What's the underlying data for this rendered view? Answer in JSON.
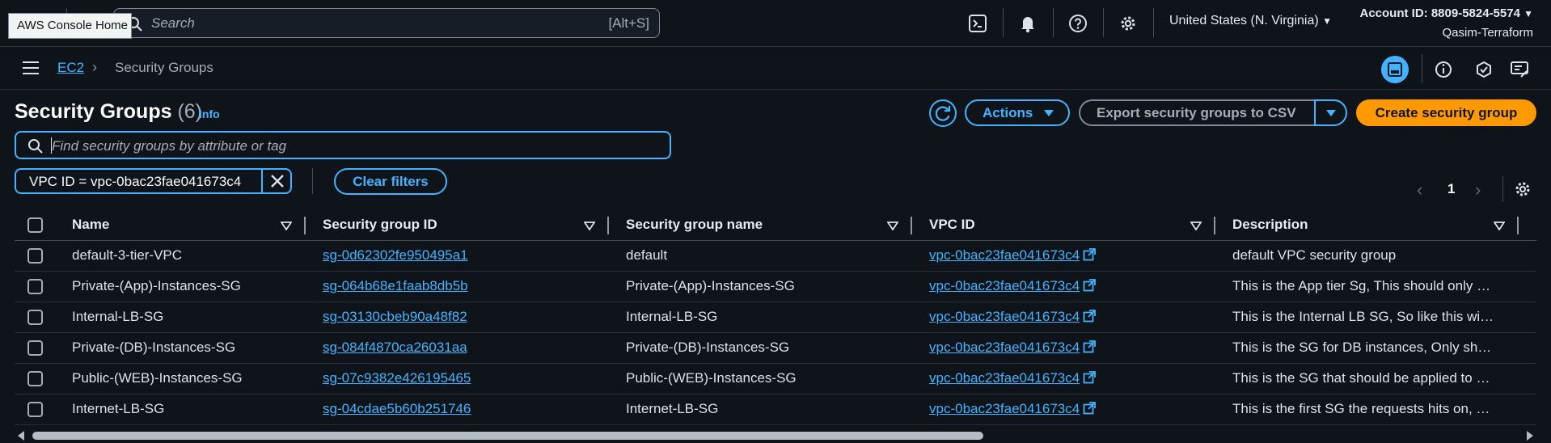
{
  "topnav": {
    "logo_text": "aws",
    "tooltip": "AWS Console Home",
    "search_placeholder": "Search",
    "search_shortcut": "[Alt+S]",
    "region": "United States (N. Virginia)",
    "account_id": "Account ID: 8809-5824-5574",
    "account_name": "Qasim-Terraform"
  },
  "breadcrumb": {
    "service": "EC2",
    "current": "Security Groups"
  },
  "header": {
    "title": "Security Groups",
    "count": "(6)",
    "info": "Info",
    "actions": "Actions",
    "export": "Export security groups to CSV",
    "create": "Create security group"
  },
  "filter": {
    "placeholder": "Find security groups by attribute or tag",
    "token": "VPC ID = vpc-0bac23fae041673c4",
    "clear": "Clear filters"
  },
  "pagination": {
    "page": "1"
  },
  "table": {
    "columns": [
      "Name",
      "Security group ID",
      "Security group name",
      "VPC ID",
      "Description"
    ],
    "rows": [
      {
        "name": "default-3-tier-VPC",
        "id": "sg-0d62302fe950495a1",
        "group_name": "default",
        "vpc": "vpc-0bac23fae041673c4",
        "desc": "default VPC security group"
      },
      {
        "name": "Private-(App)-Instances-SG",
        "id": "sg-064b68e1faab8db5b",
        "group_name": "Private-(App)-Instances-SG",
        "vpc": "vpc-0bac23fae041673c4",
        "desc": "This is the App tier Sg, This should only …"
      },
      {
        "name": "Internal-LB-SG",
        "id": "sg-03130cbeb90a48f82",
        "group_name": "Internal-LB-SG",
        "vpc": "vpc-0bac23fae041673c4",
        "desc": "This is the Internal LB SG, So like this wi…"
      },
      {
        "name": "Private-(DB)-Instances-SG",
        "id": "sg-084f4870ca26031aa",
        "group_name": "Private-(DB)-Instances-SG",
        "vpc": "vpc-0bac23fae041673c4",
        "desc": "This is the SG for DB instances, Only sh…"
      },
      {
        "name": "Public-(WEB)-Instances-SG",
        "id": "sg-07c9382e426195465",
        "group_name": "Public-(WEB)-Instances-SG",
        "vpc": "vpc-0bac23fae041673c4",
        "desc": "This is the SG that should be applied to …"
      },
      {
        "name": "Internet-LB-SG",
        "id": "sg-04cdae5b60b251746",
        "group_name": "Internet-LB-SG",
        "vpc": "vpc-0bac23fae041673c4",
        "desc": "This is the first SG the requests hits on, …"
      }
    ]
  },
  "colors": {
    "link": "#42b4ff",
    "primary": "#ff9900",
    "background": "#0f141a"
  }
}
